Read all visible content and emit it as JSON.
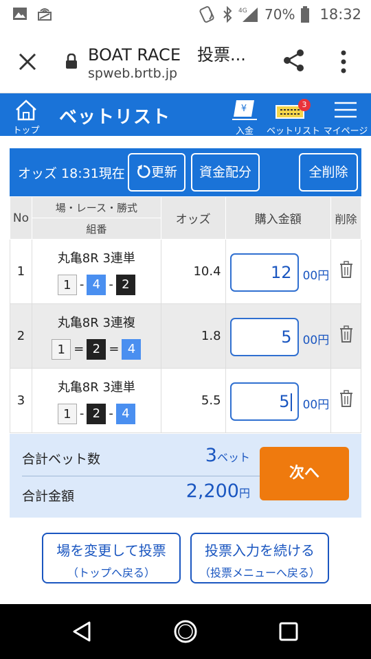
{
  "status_bar": {
    "battery_percent": "70%",
    "time": "18:32",
    "network": "4G"
  },
  "browser": {
    "title": "BOAT RACE　投票...",
    "domain": "spweb.brtb.jp"
  },
  "header": {
    "home_label": "トップ",
    "title": "ベットリスト",
    "deposit_label": "入金",
    "betlist_label": "ベットリスト",
    "betlist_badge": "3",
    "mypage_label": "マイページ"
  },
  "odds_bar": {
    "odds_time": "オッズ 18:31現在",
    "refresh_label": "更新",
    "allocation_label": "資金配分",
    "delete_all_label": "全削除"
  },
  "table": {
    "headers": {
      "no": "No",
      "race": "場・レース・勝式",
      "combo": "組番",
      "odds": "オッズ",
      "amount": "購入金額",
      "delete": "削除"
    },
    "rows": [
      {
        "no": "1",
        "race": "丸亀8R 3連単",
        "b1": "1",
        "s1": "-",
        "b2": "4",
        "s2": "-",
        "b3": "2",
        "odds": "10.4",
        "amount": "12",
        "unit": "00円"
      },
      {
        "no": "2",
        "race": "丸亀8R 3連複",
        "b1": "1",
        "s1": "=",
        "b2": "2",
        "s2": "=",
        "b3": "4",
        "odds": "1.8",
        "amount": "5",
        "unit": "00円"
      },
      {
        "no": "3",
        "race": "丸亀8R 3連単",
        "b1": "1",
        "s1": "-",
        "b2": "2",
        "s2": "-",
        "b3": "4",
        "odds": "5.5",
        "amount": "5",
        "unit": "00円"
      }
    ]
  },
  "summary": {
    "bet_count_label": "合計ベット数",
    "bet_count": "3",
    "bet_unit": "ベット",
    "total_label": "合計金額",
    "total": "2,200",
    "total_unit": "円",
    "next_label": "次へ"
  },
  "bottom": {
    "change_line1": "場を変更して投票",
    "change_line2": "（トップへ戻る）",
    "continue_line1": "投票入力を続ける",
    "continue_line2": "（投票メニューへ戻る）"
  },
  "colors": {
    "brand_blue": "#1a73d8",
    "next_orange": "#ef7a0e",
    "summary_bg": "#dce9fa"
  },
  "icons": [
    "gallery-icon",
    "broadcast-icon",
    "nfc-icon",
    "bluetooth-icon",
    "signal-icon",
    "battery-icon",
    "close-icon",
    "lock-icon",
    "share-icon",
    "more-icon",
    "home-icon",
    "deposit-icon",
    "betlist-icon",
    "menu-icon",
    "refresh-icon",
    "trash-icon",
    "back-icon",
    "home-circle-icon",
    "recent-apps-icon"
  ]
}
